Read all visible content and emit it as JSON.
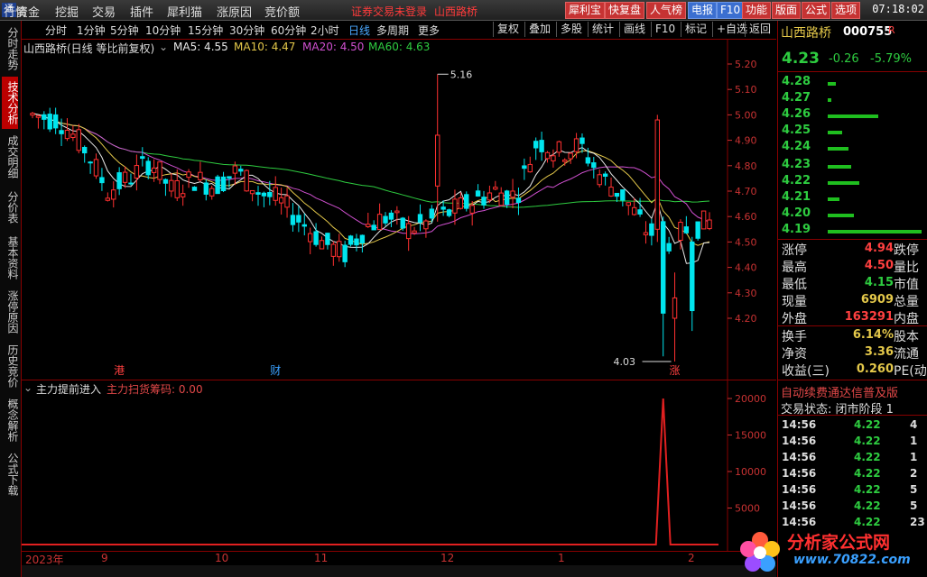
{
  "menu": {
    "items": [
      "行情",
      "资金",
      "挖掘",
      "交易",
      "插件",
      "犀利猫",
      "涨原因",
      "竞价额"
    ],
    "warning": "证券交易未登录",
    "stock_name": "山西路桥",
    "top_buttons": [
      "犀利宝",
      "快复盘",
      "人气榜",
      "电报",
      "F10",
      "功能",
      "版面",
      "公式",
      "选项"
    ],
    "clock": "07:18:02"
  },
  "left_tabs": [
    "分时走势",
    "技术分析",
    "成交明细",
    "分价表",
    "基本资料",
    "涨停原因",
    "历史竞价",
    "概念解析",
    "公式下载"
  ],
  "active_left_tab": "技术分析",
  "toolbar": {
    "periods": [
      "分时",
      "1分钟",
      "5分钟",
      "10分钟",
      "15分钟",
      "30分钟",
      "60分钟",
      "2小时",
      "日线",
      "多周期",
      "更多"
    ],
    "selected_period": "日线",
    "right_buttons": [
      "复权",
      "叠加",
      "多股",
      "统计",
      "画线",
      "F10",
      "标记",
      "+自选",
      "返回"
    ]
  },
  "chart_header": {
    "title": "山西路桥(日线 等比前复权)",
    "ma5": "MA5: 4.55",
    "ma10": "MA10: 4.47",
    "ma20": "MA20: 4.50",
    "ma60": "MA60: 4.63"
  },
  "price_axis": [
    "5.20",
    "5.10",
    "5.00",
    "4.90",
    "4.80",
    "4.70",
    "4.60",
    "4.50",
    "4.40",
    "4.30",
    "4.20"
  ],
  "annotations": {
    "high_label": "5.16",
    "low_label": "4.03",
    "markers": [
      "港",
      "财",
      "涨"
    ]
  },
  "indicator": {
    "name": "主力提前进入",
    "line_label": "主力扫货筹码: 0.00",
    "axis": [
      "20000",
      "15000",
      "10000",
      "5000"
    ]
  },
  "date_axis": [
    "2023年",
    "9",
    "10",
    "11",
    "12",
    "1",
    "2"
  ],
  "quote": {
    "name": "山西路桥",
    "code": "000755",
    "flag": "R",
    "price": "4.23",
    "change": "-0.26",
    "pct": "-5.79%",
    "sell_prices": [
      "4.28",
      "4.27",
      "4.26",
      "4.25",
      "4.24"
    ],
    "buy_prices": [
      "4.23",
      "4.22",
      "4.21",
      "4.20",
      "4.19"
    ],
    "sell_volumes": [
      7,
      3,
      43,
      12,
      18
    ],
    "buy_volumes": [
      20,
      27,
      10,
      22,
      80
    ],
    "stats_left": [
      {
        "label": "涨停",
        "value": "4.94",
        "color": "#ff4040"
      },
      {
        "label": "最高",
        "value": "4.50",
        "color": "#ff4040"
      },
      {
        "label": "最低",
        "value": "4.15",
        "color": "#2ecc40"
      },
      {
        "label": "现量",
        "value": "6909",
        "color": "#e4c84a"
      },
      {
        "label": "外盘",
        "value": "163291",
        "color": "#ff4040"
      }
    ],
    "stats_right": [
      "跌停",
      "量比",
      "市值",
      "总量",
      "内盘"
    ],
    "stats2_left": [
      {
        "label": "换手",
        "value": "6.14%",
        "color": "#e4c84a"
      },
      {
        "label": "净资",
        "value": "3.36",
        "color": "#e4c84a"
      },
      {
        "label": "收益(三)",
        "value": "0.260",
        "color": "#e4c84a"
      }
    ],
    "stats2_right": [
      "股本",
      "流通",
      "PE(动"
    ],
    "scroll_text": "自动续费通达信普及版",
    "trade_state": "交易状态: 闭市阶段 1",
    "ticks": [
      {
        "time": "14:56",
        "price": "4.22",
        "vol": "4"
      },
      {
        "time": "14:56",
        "price": "4.22",
        "vol": "1"
      },
      {
        "time": "14:56",
        "price": "4.22",
        "vol": "1"
      },
      {
        "time": "14:56",
        "price": "4.22",
        "vol": "2"
      },
      {
        "time": "14:56",
        "price": "4.22",
        "vol": "5"
      },
      {
        "time": "14:56",
        "price": "4.22",
        "vol": "5"
      },
      {
        "time": "14:56",
        "price": "4.22",
        "vol": "23"
      }
    ]
  },
  "watermark": {
    "title": "分析家公式网",
    "url": "www.70822.com"
  },
  "colors": {
    "up": "#ff3030",
    "down": "#00e5ee",
    "ma5": "#e8e8e8",
    "ma10": "#e4c84a",
    "ma20": "#d050d0",
    "ma60": "#2ecc40"
  }
}
